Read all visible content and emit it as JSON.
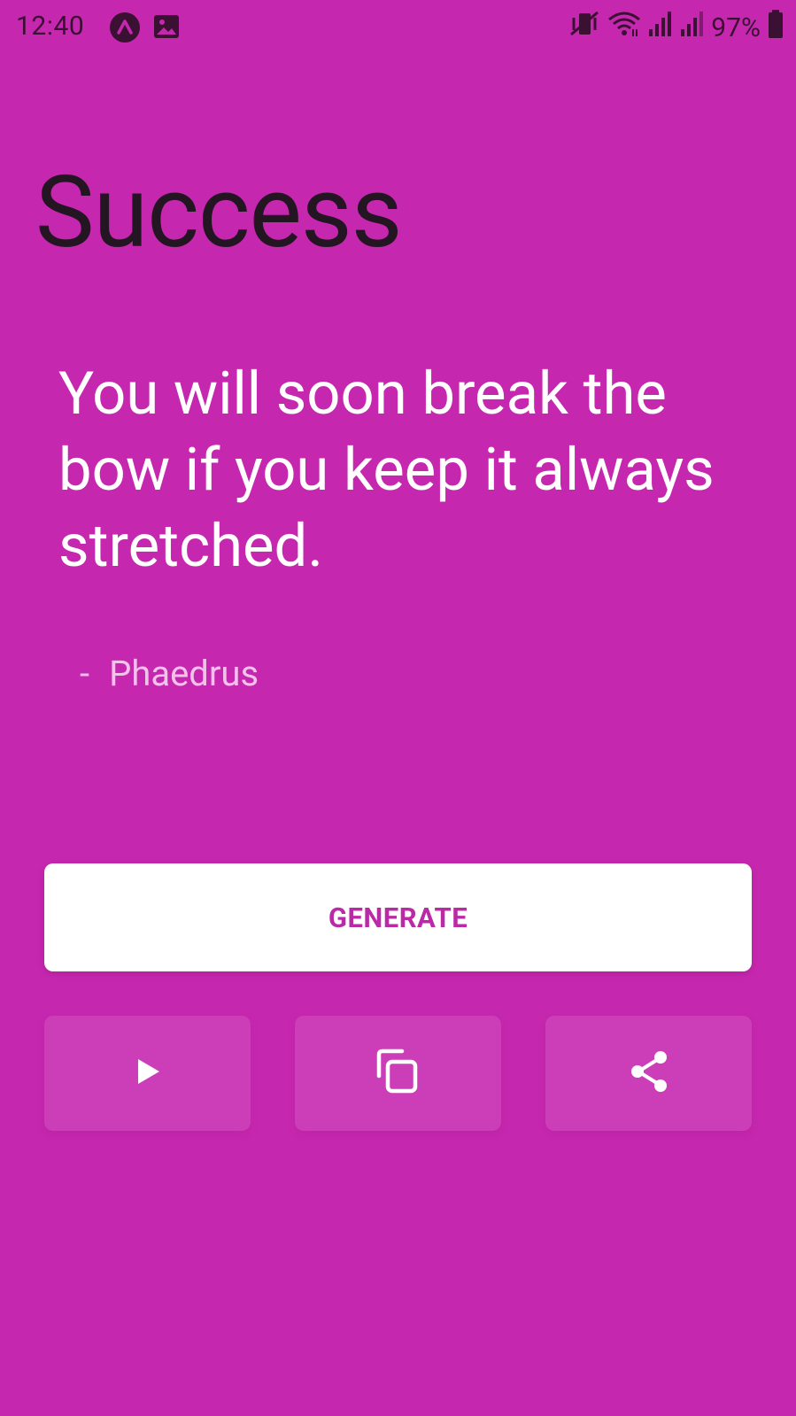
{
  "status_bar": {
    "time": "12:40",
    "battery": "97%",
    "icons": [
      "assistant-icon",
      "image-icon",
      "vibrate-icon",
      "wifi-icon",
      "signal-icon",
      "signal-icon-2",
      "battery-icon"
    ]
  },
  "page": {
    "title": "Success",
    "quote": "You will soon break the bow if you keep it always stretched.",
    "author_dash": "-",
    "author": "Phaedrus"
  },
  "buttons": {
    "generate_label": "GENERATE",
    "actions": [
      "play-icon",
      "copy-icon",
      "share-icon"
    ]
  },
  "colors": {
    "background": "#c627af",
    "accent_text": "#bb2aa6",
    "title_text": "#231622",
    "quote_text": "#ffffff"
  }
}
